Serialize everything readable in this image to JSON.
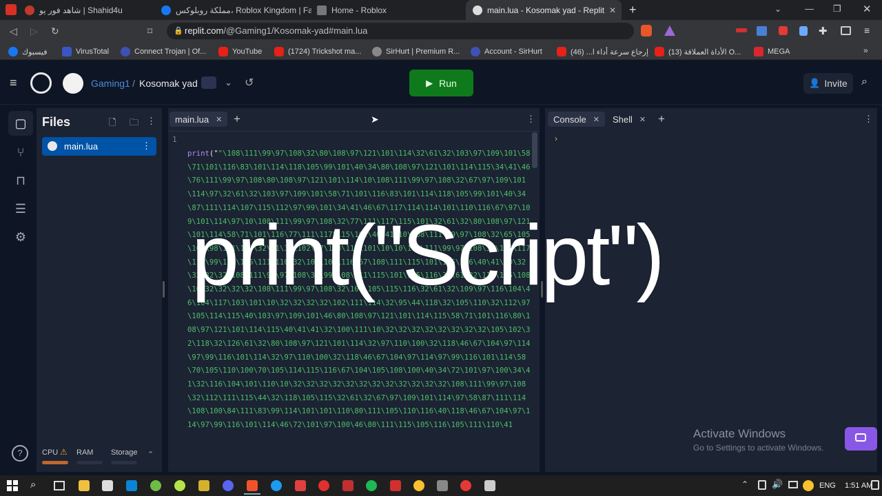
{
  "browser": {
    "tabs": [
      {
        "title": "شاهد فور يو | Shahid4u",
        "color": "#c0392b"
      },
      {
        "title": "مملكة روبلوكس، Roblox Kingdom | Fac",
        "color": "#1877f2"
      },
      {
        "title": "Home - Roblox",
        "color": "#777777"
      },
      {
        "title": "main.lua - Kosomak yad - Replit",
        "color": "#dddddd"
      }
    ],
    "url_domain": "replit.com",
    "url_path": "/@Gaming1/Kosomak-yad#main.lua",
    "bookmarks": [
      "فيسبوك",
      "VirusTotal",
      "Connect Trojan | Of...",
      "YouTube",
      "(1724) Trickshot ma...",
      "SirHurt | Premium R...",
      "Account - SirHurt",
      "إرجاع سرعة أداء ا... (46)",
      "الأداة العملاقة (13) O...",
      "MEGA"
    ]
  },
  "replit": {
    "user": "Gaming1",
    "separator": "/",
    "repl_name": "Kosomak yad",
    "run_label": "Run",
    "invite_label": "Invite",
    "files_title": "Files",
    "file_name": "main.lua",
    "editor_tab": "main.lua",
    "console_tab": "Console",
    "shell_tab": "Shell",
    "line_number": "1",
    "code_fn": "print",
    "code_open": "(\"",
    "code_body": "\"\\108\\111\\99\\97\\108\\32\\80\\108\\97\\121\\101\\114\\32\\61\\32\\103\\97\\109\\101\\58\\71\\101\\116\\83\\101\\114\\118\\105\\99\\101\\40\\34\\80\\108\\97\\121\\101\\114\\115\\34\\41\\46\\76\\111\\99\\97\\108\\80\\108\\97\\121\\101\\114\\10\\108\\111\\99\\97\\108\\32\\67\\97\\109\\101\\114\\97\\32\\61\\32\\103\\97\\109\\101\\58\\71\\101\\116\\83\\101\\114\\118\\105\\99\\101\\40\\34\\87\\111\\114\\107\\115\\112\\97\\99\\101\\34\\41\\46\\67\\117\\114\\114\\101\\110\\116\\67\\97\\109\\101\\114\\97\\10\\108\\111\\99\\97\\108\\32\\77\\111\\117\\115\\101\\32\\61\\32\\80\\108\\97\\121\\101\\114\\58\\71\\101\\116\\77\\111\\117\\115\\101\\40\\41\\10\\108\\111\\99\\97\\108\\32\\65\\105\\109\\98\\111\\116\\32\\61\\32\\102\\97\\108\\115\\101\\10\\10\\108\\111\\99\\97\\108\\32\\102\\117\\110\\99\\116\\105\\111\\110\\32\\103\\101\\116\\67\\108\\111\\115\\101\\115\\116\\40\\41\\10\\32\\32\\32\\32\\108\\111\\99\\97\\108\\32\\99\\108\\111\\115\\101\\115\\116\\32\\61\\32\\110\\105\\108\\10\\32\\32\\32\\32\\108\\111\\99\\97\\108\\32\\100\\105\\115\\116\\32\\61\\32\\109\\97\\116\\104\\46\\104\\117\\103\\101\\10\\32\\32\\32\\32\\102\\111\\114\\32\\95\\44\\118\\32\\105\\110\\32\\112\\97\\105\\114\\115\\40\\103\\97\\109\\101\\46\\80\\108\\97\\121\\101\\114\\115\\58\\71\\101\\116\\80\\108\\97\\121\\101\\114\\115\\40\\41\\41\\32\\100\\111\\10\\32\\32\\32\\32\\32\\32\\32\\32\\105\\102\\32\\118\\32\\126\\61\\32\\80\\108\\97\\121\\101\\114\\32\\97\\110\\100\\32\\118\\46\\67\\104\\97\\114\\97\\99\\116\\101\\114\\32\\97\\110\\100\\32\\118\\46\\67\\104\\97\\114\\97\\99\\116\\101\\114\\58\\70\\105\\110\\100\\70\\105\\114\\115\\116\\67\\104\\105\\108\\100\\40\\34\\72\\101\\97\\100\\34\\41\\32\\116\\104\\101\\110\\10\\32\\32\\32\\32\\32\\32\\32\\32\\32\\32\\32\\32\\108\\111\\99\\97\\108\\32\\112\\111\\115\\44\\32\\118\\105\\115\\32\\61\\32\\67\\97\\109\\101\\114\\97\\58\\87\\111\\114\\108\\100\\84\\111\\83\\99\\114\\101\\101\\110\\80\\111\\105\\110\\116\\40\\118\\46\\67\\104\\97\\114\\97\\99\\116\\101\\114\\46\\72\\101\\97\\100\\46\\80\\111\\115\\105\\116\\105\\111\\110\\41",
    "overlay_text": "print(\"Script\")",
    "activate_title": "Activate Windows",
    "activate_sub": "Go to Settings to activate Windows.",
    "resources": {
      "cpu": "CPU",
      "ram": "RAM",
      "storage": "Storage"
    }
  },
  "taskbar": {
    "lang": "ENG",
    "time": "1:51 AM"
  }
}
